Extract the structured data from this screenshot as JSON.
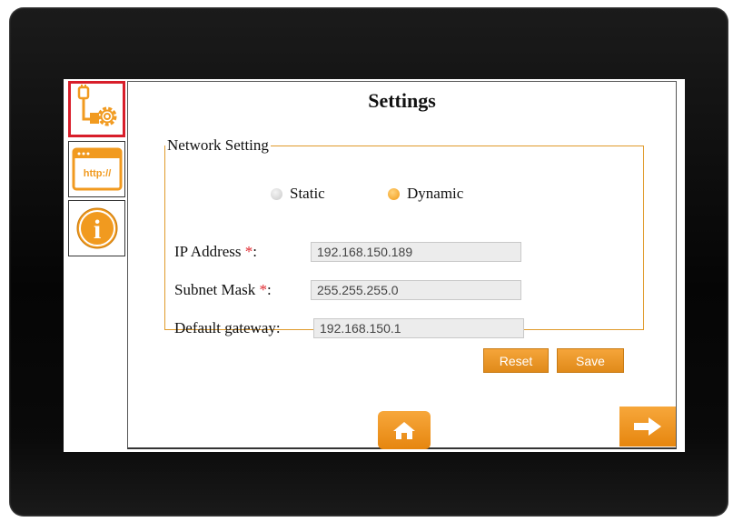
{
  "page": {
    "title": "Settings"
  },
  "sidebar": {
    "items": [
      {
        "name": "network-settings",
        "icon": "network-gear-icon",
        "active": true
      },
      {
        "name": "http-settings",
        "icon": "browser-http-icon",
        "label": "http://"
      },
      {
        "name": "information",
        "icon": "info-icon",
        "glyph": "i"
      }
    ]
  },
  "network": {
    "legend": "Network Setting",
    "mode_options": [
      {
        "label": "Static",
        "selected": false
      },
      {
        "label": "Dynamic",
        "selected": true
      }
    ],
    "fields": [
      {
        "label": "IP Address ",
        "required": "*",
        "colon": ":",
        "value": "192.168.150.189"
      },
      {
        "label": "Subnet Mask ",
        "required": "*",
        "colon": ":",
        "value": "255.255.255.0"
      },
      {
        "label": "Default gateway:",
        "required": "",
        "colon": "",
        "value": "192.168.150.1"
      }
    ]
  },
  "actions": {
    "reset_label": "Reset",
    "save_label": "Save"
  },
  "nav": {
    "home_icon": "home-icon",
    "next_icon": "arrow-right-icon"
  },
  "colors": {
    "accent": "#F19A1F",
    "active_border": "#D81E2A",
    "required": "#E0262D",
    "bezel": "#0A0A0A"
  }
}
